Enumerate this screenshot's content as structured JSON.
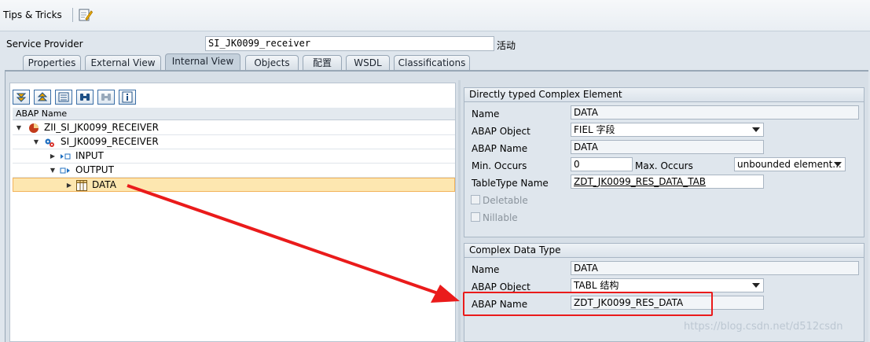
{
  "menu": {
    "tips_tricks": "Tips & Tricks"
  },
  "header": {
    "service_provider_label": "Service Provider",
    "service_provider_value": "SI_JK0099_receiver",
    "status": "活动"
  },
  "tabs": [
    {
      "label": "Properties"
    },
    {
      "label": "External View"
    },
    {
      "label": "Internal View"
    },
    {
      "label": "Objects"
    },
    {
      "label": "配置"
    },
    {
      "label": "WSDL"
    },
    {
      "label": "Classifications"
    }
  ],
  "active_tab": "Internal View",
  "tree": {
    "column_header": "ABAP Name",
    "nodes": [
      {
        "label": "ZII_SI_JK0099_RECEIVER",
        "level": 0,
        "expanded": true
      },
      {
        "label": "SI_JK0099_RECEIVER",
        "level": 1,
        "expanded": true
      },
      {
        "label": "INPUT",
        "level": 2,
        "expanded": false
      },
      {
        "label": "OUTPUT",
        "level": 2,
        "expanded": true
      },
      {
        "label": "DATA",
        "level": 3,
        "expanded": false,
        "selected": true
      }
    ]
  },
  "element_group": {
    "title": "Directly typed Complex Element",
    "name_label": "Name",
    "name_value": "DATA",
    "abap_object_label": "ABAP Object",
    "abap_object_value": "FIEL 字段",
    "abap_name_label": "ABAP Name",
    "abap_name_value": "DATA",
    "min_occurs_label": "Min. Occurs",
    "min_occurs_value": "0",
    "max_occurs_label": "Max. Occurs",
    "max_occurs_value": "unbounded element...",
    "tabletype_label": "TableType Name",
    "tabletype_value": "ZDT_JK0099_RES_DATA_TAB",
    "deletable_label": "Deletable",
    "nillable_label": "Nillable"
  },
  "datatype_group": {
    "title": "Complex Data Type",
    "name_label": "Name",
    "name_value": "DATA",
    "abap_object_label": "ABAP Object",
    "abap_object_value": "TABL 结构",
    "abap_name_label": "ABAP Name",
    "abap_name_value": "ZDT_JK0099_RES_DATA"
  },
  "watermark": "https://blog.csdn.net/d512csdn",
  "colors": {
    "annotation": "#ea1b1b",
    "selection": "#fde7b0",
    "accent": "#3a6ea6"
  }
}
